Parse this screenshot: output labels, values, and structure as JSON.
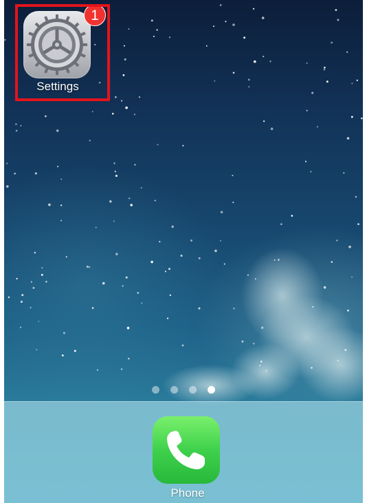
{
  "home_screen": {
    "apps": [
      {
        "label": "Settings",
        "icon": "gear-icon",
        "badge": "1"
      }
    ],
    "page_indicator": {
      "pages": 4,
      "current": 4
    },
    "dock": {
      "apps": [
        {
          "label": "Phone",
          "icon": "phone-handset-icon"
        }
      ]
    }
  },
  "colors": {
    "highlight": "#e3141b",
    "badge": "#f2322e",
    "phone_green": "#3fd14c"
  }
}
